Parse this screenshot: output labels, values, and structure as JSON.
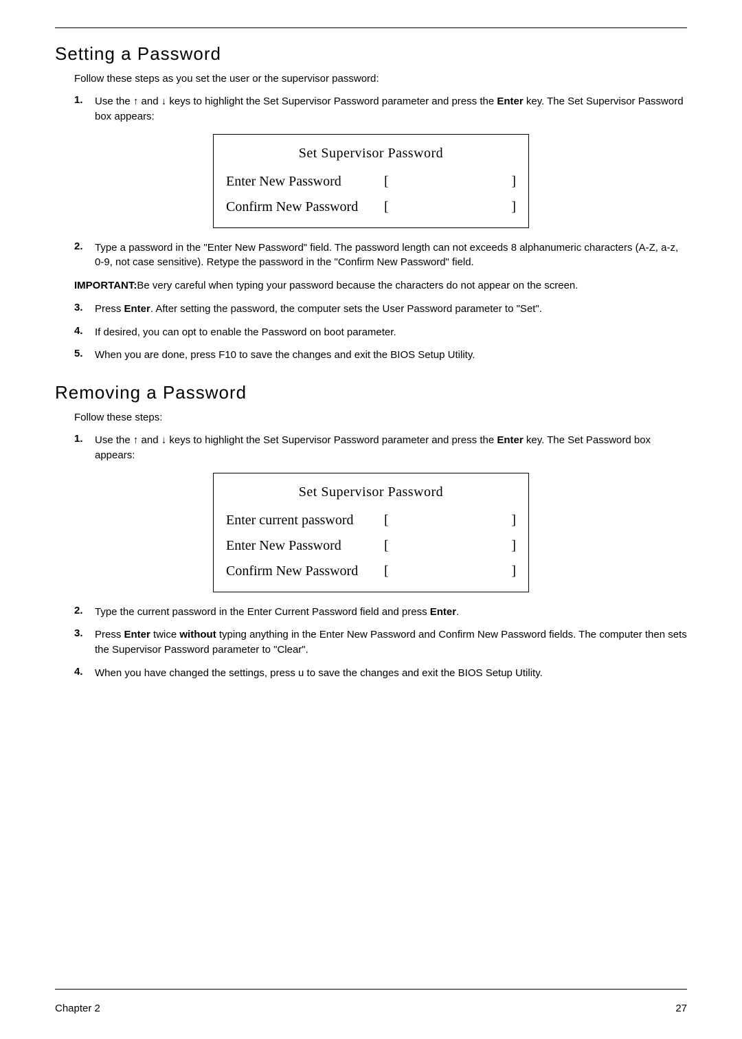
{
  "section1": {
    "title": "Setting a Password",
    "intro": "Follow these steps as you set the user or the supervisor password:",
    "step1_pre": "Use the ",
    "step1_up": "↑",
    "step1_mid1": " and ",
    "step1_down": "↓",
    "step1_mid2": " keys to highlight the Set Supervisor Password parameter and press the ",
    "step1_enter": "Enter",
    "step1_post": " key. The Set Supervisor Password box appears:",
    "step2": "Type a password in the \"Enter New Password\" field. The password length can not exceeds 8 alphanumeric characters (A-Z, a-z, 0-9, not case sensitive). Retype the password in the \"Confirm New Password\" field.",
    "important_label": "IMPORTANT:",
    "important_text": "Be very careful when typing your password because the characters do not appear on the screen.",
    "step3_pre": "Press ",
    "step3_enter": "Enter",
    "step3_post": ". After setting the password, the computer sets the User Password parameter to \"Set\".",
    "step4": "If desired, you can opt to enable the Password on boot parameter.",
    "step5": "When you are done, press F10 to save the changes and exit the BIOS Setup Utility."
  },
  "bios1": {
    "title": "Set Supervisor Password",
    "row1": "Enter New Password",
    "row2": "Confirm New Password"
  },
  "section2": {
    "title": "Removing a Password",
    "intro": "Follow these steps:",
    "step1_pre": "Use the ",
    "step1_up": "↑",
    "step1_mid1": " and ",
    "step1_down": "↓",
    "step1_mid2": " keys to highlight the Set Supervisor Password parameter and press the ",
    "step1_enter": "Enter",
    "step1_post": " key. The Set Password box appears:",
    "step2_pre": "Type the current password in the Enter Current Password field and press ",
    "step2_enter": "Enter",
    "step2_post": ".",
    "step3_pre": "Press ",
    "step3_enter": "Enter",
    "step3_mid1": " twice ",
    "step3_without": "without",
    "step3_post": " typing anything in the Enter New Password and Confirm New Password fields. The computer then sets the Supervisor Password parameter to \"Clear\".",
    "step4": "When you have changed the settings, press u to save the changes and exit the BIOS Setup Utility."
  },
  "bios2": {
    "title": "Set Supervisor Password",
    "row1": "Enter current password",
    "row2": "Enter New Password",
    "row3": "Confirm New Password"
  },
  "brackets": {
    "open": "[",
    "close": "]"
  },
  "nums": {
    "n1": "1.",
    "n2": "2.",
    "n3": "3.",
    "n4": "4.",
    "n5": "5."
  },
  "footer": {
    "left": "Chapter 2",
    "right": "27"
  }
}
